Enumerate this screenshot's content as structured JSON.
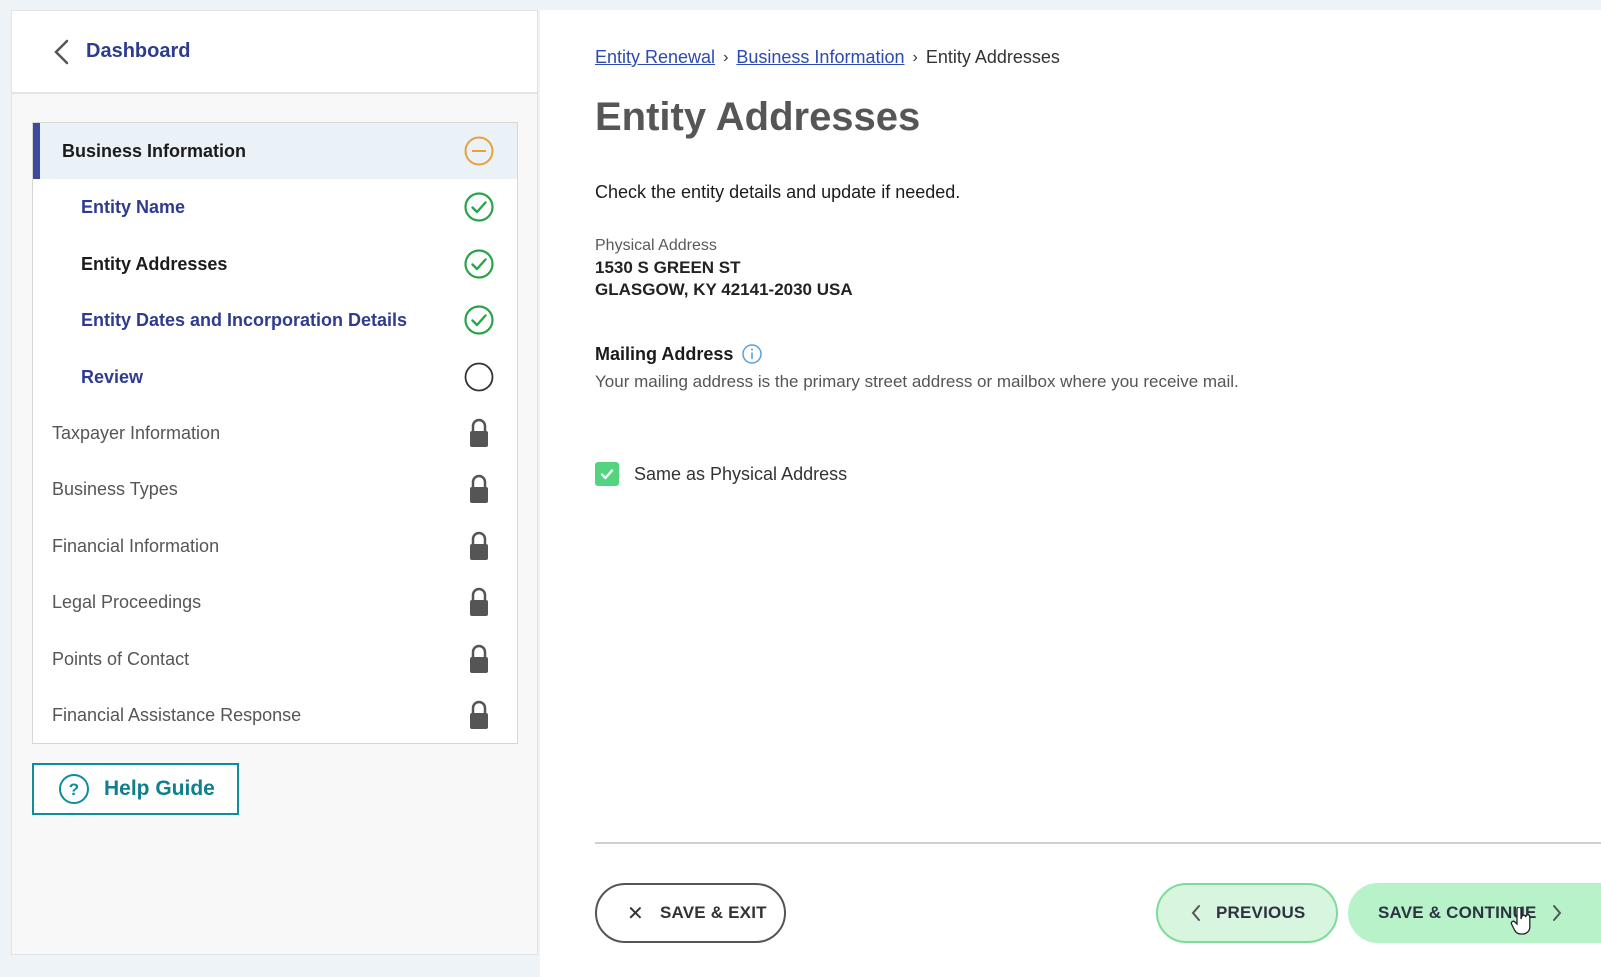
{
  "sidebar": {
    "dashboard_label": "Dashboard",
    "section_head": {
      "label": "Business Information",
      "status": "in-progress"
    },
    "sub_items": [
      {
        "label": "Entity Name",
        "status": "complete"
      },
      {
        "label": "Entity Addresses",
        "status": "complete",
        "active": true
      },
      {
        "label": "Entity Dates and Incorporation Details",
        "status": "complete"
      },
      {
        "label": "Review",
        "status": "not-started"
      }
    ],
    "locked_items": [
      {
        "label": "Taxpayer Information"
      },
      {
        "label": "Business Types"
      },
      {
        "label": "Financial Information"
      },
      {
        "label": "Legal Proceedings"
      },
      {
        "label": "Points of Contact"
      },
      {
        "label": "Financial Assistance Response"
      }
    ],
    "help_label": "Help Guide"
  },
  "breadcrumb": {
    "items": [
      "Entity Renewal",
      "Business Information",
      "Entity Addresses"
    ],
    "separator": "›"
  },
  "page": {
    "title": "Entity Addresses",
    "intro": "Check the entity details and update if needed.",
    "physical_address_label": "Physical Address",
    "physical_address_line1": "1530 S GREEN ST",
    "physical_address_line2": "GLASGOW, KY 42141-2030 USA",
    "mailing_address_label": "Mailing Address",
    "mailing_address_desc": "Your mailing address is the primary street address or mailbox where you receive mail.",
    "same_as_physical_label": "Same as Physical Address",
    "same_as_physical_checked": true
  },
  "footer": {
    "save_exit_label": "SAVE & EXIT",
    "previous_label": "PREVIOUS",
    "save_continue_label": "SAVE & CONTINUE"
  },
  "colors": {
    "accent_blue": "#2e3b8f",
    "teal": "#0e8d9d",
    "complete_green": "#2aa34a",
    "progress_orange": "#e8a13a",
    "button_green": "#b7f2c9"
  }
}
